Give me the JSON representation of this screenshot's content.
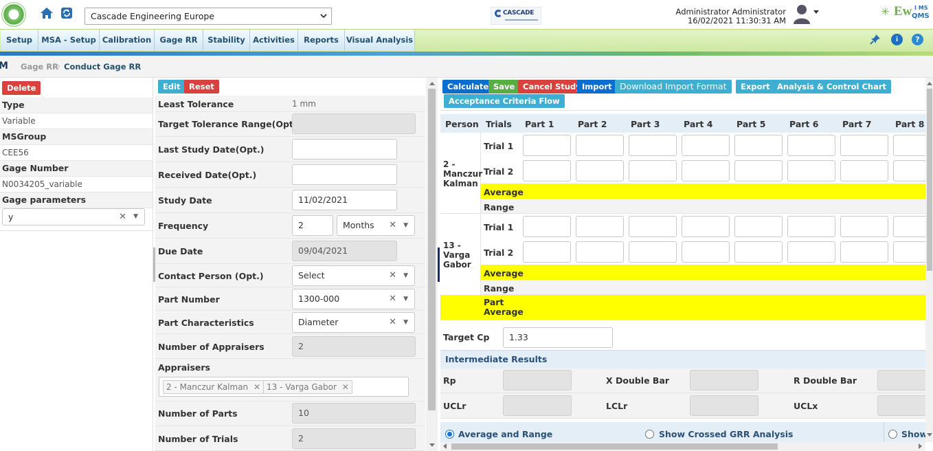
{
  "company": "Cascade Engineering Europe",
  "user": {
    "name": "Administrator Administrator",
    "datetime": "16/02/2021 11:30:31 AM"
  },
  "brand": {
    "logo_text": "CASCADE",
    "ims_text": "Ew",
    "ims_sup": "I MS",
    "ims_sub": "QMS"
  },
  "menu": [
    "Setup",
    "MSA - Setup",
    "Calibration",
    "Gage RR",
    "Stability",
    "Activities",
    "Reports",
    "Visual Analysis"
  ],
  "breadcrumb": {
    "root": "M",
    "parent": "Gage RR",
    "current": "Conduct Gage RR"
  },
  "left_panel": {
    "delete_label": "Delete",
    "type_label": "Type",
    "type_value": "Variable",
    "msgroup_label": "MSGroup",
    "msgroup_value": "CEE56",
    "gage_number_label": "Gage Number",
    "gage_number_value": "N0034205_variable",
    "gage_params_label": "Gage parameters",
    "gage_params_value": "y"
  },
  "middle_panel": {
    "edit_label": "Edit",
    "reset_label": "Reset",
    "least_tolerance_label": "Least Tolerance",
    "least_tolerance_value": "1 mm",
    "target_tol_label": "Target Tolerance Range(Opt)",
    "last_study_label": "Last Study Date(Opt.)",
    "received_label": "Received Date(Opt.)",
    "study_date_label": "Study Date",
    "study_date_value": "11/02/2021",
    "frequency_label": "Frequency",
    "frequency_value": "2",
    "frequency_unit": "Months",
    "due_date_label": "Due Date",
    "due_date_value": "09/04/2021",
    "contact_label": "Contact Person (Opt.)",
    "contact_value": "Select",
    "part_number_label": "Part Number",
    "part_number_value": "1300-000",
    "part_char_label": "Part Characteristics",
    "part_char_value": "Diameter",
    "num_appraisers_label": "Number of Appraisers",
    "num_appraisers_value": "2",
    "appraisers_label": "Appraisers",
    "appraisers": [
      "2 - Manczur Kalman",
      "13 - Varga Gabor"
    ],
    "num_parts_label": "Number of Parts",
    "num_parts_value": "10",
    "num_trials_label": "Number of Trials",
    "num_trials_value": "2"
  },
  "right_panel": {
    "buttons": {
      "calculate": "Calculate",
      "save": "Save",
      "cancel": "Cancel Study",
      "import": "Import",
      "download": "Download Import Format",
      "export": "Export",
      "analysis": "Analysis & Control Chart",
      "acceptance": "Acceptance Criteria Flow"
    },
    "grid": {
      "person_header": "Person",
      "trials_header": "Trials",
      "parts": [
        "Part 1",
        "Part 2",
        "Part 3",
        "Part 4",
        "Part 5",
        "Part 6",
        "Part 7",
        "Part 8"
      ],
      "persons": [
        {
          "name": "2 - Manczur Kalman",
          "trials": [
            "Trial 1",
            "Trial 2"
          ],
          "average": "Average",
          "range": "Range"
        },
        {
          "name": "13 - Varga Gabor",
          "trials": [
            "Trial 1",
            "Trial 2"
          ],
          "average": "Average",
          "range": "Range"
        }
      ],
      "part_average": "Part Average"
    },
    "target_cp_label": "Target Cp",
    "target_cp_value": "1.33",
    "intermediate_label": "Intermediate Results",
    "rp_label": "Rp",
    "xdb_label": "X Double Bar",
    "rdb_label": "R Double Bar",
    "uclr_label": "UCLr",
    "lclr_label": "LCLr",
    "uclx_label": "UCLx",
    "radio_avg": "Average and Range",
    "radio_crossed": "Show Crossed GRR Analysis",
    "radio_show": "Show"
  }
}
